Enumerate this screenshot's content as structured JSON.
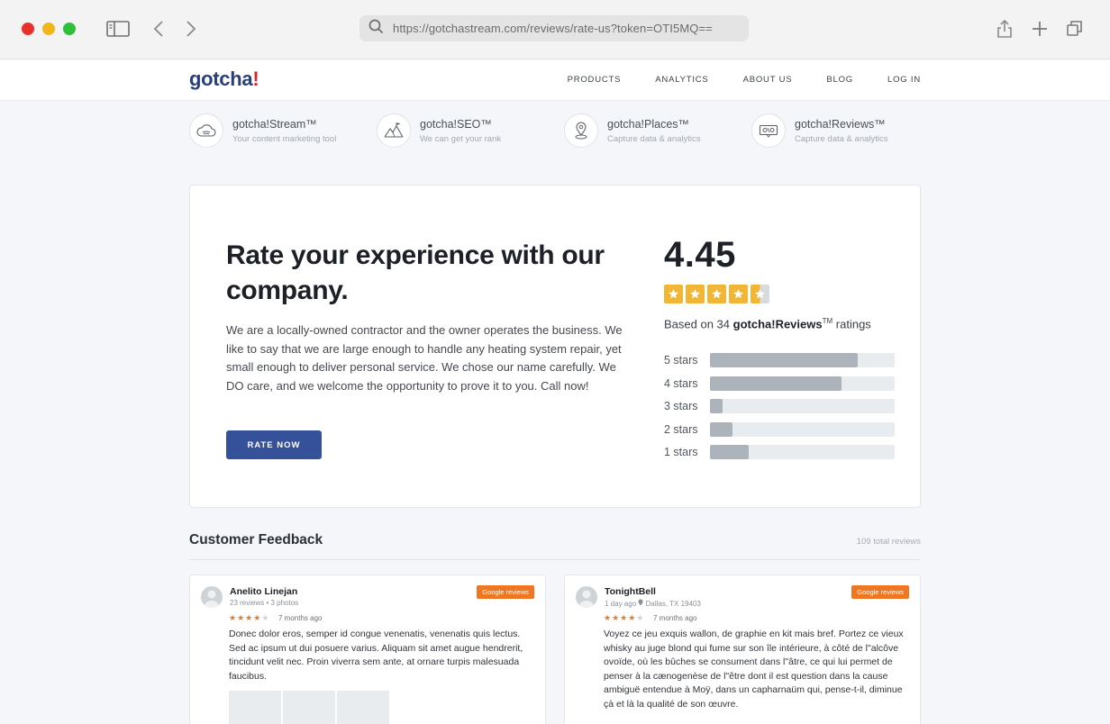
{
  "browser": {
    "url": "https://gotchastream.com/reviews/rate-us?token=OTI5MQ=="
  },
  "nav": {
    "logo_main": "gotcha",
    "logo_bang": "!",
    "links": [
      "PRODUCTS",
      "ANALYTICS",
      "ABOUT US",
      "BLOG",
      "LOG IN"
    ]
  },
  "products": [
    {
      "name": "gotcha!Stream™",
      "sub": "Your content marketing tool",
      "icon": "cloud-icon"
    },
    {
      "name": "gotcha!SEO™",
      "sub": "We can get your rank",
      "icon": "mountain-flag-icon"
    },
    {
      "name": "gotcha!Places™",
      "sub": "Capture data & analytics",
      "icon": "map-pin-icon"
    },
    {
      "name": "gotcha!Reviews™",
      "sub": "Capture data & analytics",
      "icon": "review-ticket-icon"
    }
  ],
  "rating": {
    "headline": "Rate your experience with our company.",
    "description": "We are a locally-owned contractor and the owner operates the business. We like to say that we are large enough to handle any heating system repair, yet small enough to deliver personal service. We chose our name carefully. We DO care, and we welcome the opportunity to prove it to you. Call now!",
    "button": "RATE NOW",
    "score": "4.45",
    "stars_value": 4.45,
    "based_prefix": "Based on 34 ",
    "based_brand": "gotcha!Reviews",
    "based_tm": "TM",
    "based_suffix": " ratings",
    "breakdown": [
      {
        "label": "5 stars",
        "fraction": 0.8
      },
      {
        "label": "4 stars",
        "fraction": 0.71
      },
      {
        "label": "3 stars",
        "fraction": 0.07
      },
      {
        "label": "2 stars",
        "fraction": 0.12
      },
      {
        "label": "1 stars",
        "fraction": 0.21
      }
    ]
  },
  "feedback": {
    "title": "Customer Feedback",
    "total": "109 total reviews",
    "reviews": [
      {
        "name": "Anelito Linejan",
        "meta": "23 reviews • 3 photos",
        "badge": "Google reviews",
        "stars": 4,
        "time": "7 months ago",
        "text": "Donec dolor eros, semper id congue venenatis, venenatis quis lectus. Sed ac ipsum ut dui posuere varius. Aliquam sit amet augue hendrerit, tincidunt velit nec. Proin viverra sem ante, at ornare turpis malesuada faucibus."
      },
      {
        "name": "TonightBell",
        "meta_time": "1 day ago",
        "meta_location": "Dallas, TX 19403",
        "badge": "Google reviews",
        "stars": 4,
        "time": "7 months ago",
        "text": "Voyez ce jeu exquis wallon, de graphie en kit mais bref. Portez ce vieux whisky au juge blond qui fume sur son île intérieure, à côté de l\"alcôve ovoïde, où les bûches se consument dans l\"âtre, ce qui lui permet de penser à la cænogenèse de l\"être dont il est question dans la cause ambiguë entendue à Moÿ, dans un capharnaüm qui, pense-t-il, diminue çà et là la qualité de son œuvre."
      }
    ]
  }
}
